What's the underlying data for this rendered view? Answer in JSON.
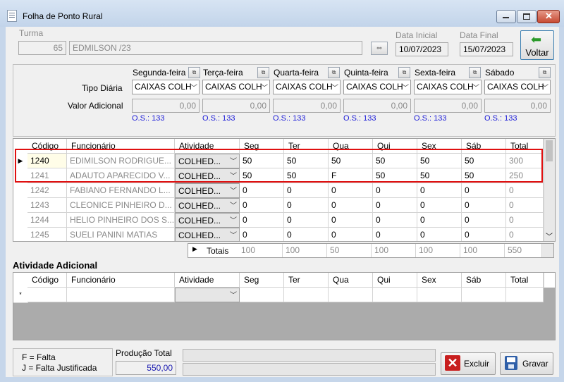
{
  "window": {
    "title": "Folha de Ponto Rural"
  },
  "header": {
    "turma_label": "Turma",
    "turma_code": "65",
    "turma_name": "EDMILSON /23",
    "data_inicial_label": "Data Inicial",
    "data_inicial": "10/07/2023",
    "data_final_label": "Data Final",
    "data_final": "15/07/2023",
    "voltar_label": "Voltar"
  },
  "diaria": {
    "tipo_label": "Tipo Diária",
    "valor_label": "Valor Adicional",
    "days": [
      {
        "name": "Segunda-feira",
        "tipo": "CAIXAS COLH",
        "valor": "0,00",
        "os": "O.S.: 133"
      },
      {
        "name": "Terça-feira",
        "tipo": "CAIXAS COLH",
        "valor": "0,00",
        "os": "O.S.: 133"
      },
      {
        "name": "Quarta-feira",
        "tipo": "CAIXAS COLH",
        "valor": "0,00",
        "os": "O.S.: 133"
      },
      {
        "name": "Quinta-feira",
        "tipo": "CAIXAS COLH",
        "valor": "0,00",
        "os": "O.S.: 133"
      },
      {
        "name": "Sexta-feira",
        "tipo": "CAIXAS COLH",
        "valor": "0,00",
        "os": "O.S.: 133"
      },
      {
        "name": "Sábado",
        "tipo": "CAIXAS COLH",
        "valor": "0,00",
        "os": "O.S.: 133"
      }
    ]
  },
  "main_grid": {
    "columns": [
      "Código",
      "Funcionário",
      "Atividade",
      "Seg",
      "Ter",
      "Qua",
      "Qui",
      "Sex",
      "Sáb",
      "Total"
    ],
    "rows": [
      [
        "1240",
        "EDIMILSON RODRIGUE...",
        "COLHED...",
        "50",
        "50",
        "50",
        "50",
        "50",
        "50",
        "300"
      ],
      [
        "1241",
        "ADAUTO APARECIDO V...",
        "COLHED...",
        "50",
        "50",
        "F",
        "50",
        "50",
        "50",
        "250"
      ],
      [
        "1242",
        "FABIANO FERNANDO L...",
        "COLHED...",
        "0",
        "0",
        "0",
        "0",
        "0",
        "0",
        "0"
      ],
      [
        "1243",
        "CLEONICE PINHEIRO D...",
        "COLHED...",
        "0",
        "0",
        "0",
        "0",
        "0",
        "0",
        "0"
      ],
      [
        "1244",
        "HELIO PINHEIRO DOS S...",
        "COLHED...",
        "0",
        "0",
        "0",
        "0",
        "0",
        "0",
        "0"
      ],
      [
        "1245",
        "SUELI PANINI MATIAS",
        "COLHED...",
        "0",
        "0",
        "0",
        "0",
        "0",
        "0",
        "0"
      ]
    ],
    "totals_label": "Totais",
    "totals": [
      "100",
      "100",
      "50",
      "100",
      "100",
      "100",
      "550"
    ],
    "highlight_color": "#e01010"
  },
  "adicional": {
    "title": "Atividade Adicional",
    "columns": [
      "Código",
      "Funcionário",
      "Atividade",
      "Seg",
      "Ter",
      "Qua",
      "Qui",
      "Sex",
      "Sáb",
      "Total"
    ],
    "new_row_marker": "*"
  },
  "footer": {
    "legend_f": "F = Falta",
    "legend_j": "J = Falta Justificada",
    "producao_label": "Produção Total",
    "producao_value": "550,00",
    "excluir_label": "Excluir",
    "gravar_label": "Gravar"
  }
}
